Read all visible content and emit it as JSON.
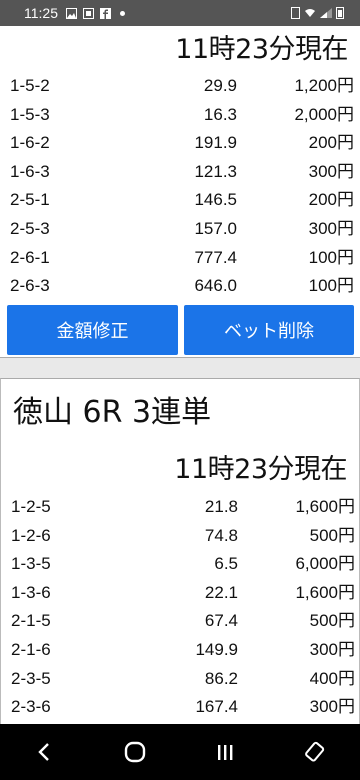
{
  "status_bar": {
    "time": "11:25",
    "icons": [
      "image-icon",
      "gallery-icon",
      "facebook-icon",
      "dot-icon"
    ],
    "right_icons": [
      "hd-icon",
      "wifi-icon",
      "signal-icon",
      "battery-icon"
    ]
  },
  "card1": {
    "as_of": "11時23分現在",
    "rows": [
      {
        "combo": "1-5-2",
        "odds": "29.9",
        "amount": "1,200円"
      },
      {
        "combo": "1-5-3",
        "odds": "16.3",
        "amount": "2,000円"
      },
      {
        "combo": "1-6-2",
        "odds": "191.9",
        "amount": "200円"
      },
      {
        "combo": "1-6-3",
        "odds": "121.3",
        "amount": "300円"
      },
      {
        "combo": "2-5-1",
        "odds": "146.5",
        "amount": "200円"
      },
      {
        "combo": "2-5-3",
        "odds": "157.0",
        "amount": "300円"
      },
      {
        "combo": "2-6-1",
        "odds": "777.4",
        "amount": "100円"
      },
      {
        "combo": "2-6-3",
        "odds": "646.0",
        "amount": "100円"
      }
    ],
    "edit_label": "金額修正",
    "delete_label": "ベット削除"
  },
  "card2": {
    "title": "徳山 6R 3連単",
    "as_of": "11時23分現在",
    "rows": [
      {
        "combo": "1-2-5",
        "odds": "21.8",
        "amount": "1,600円"
      },
      {
        "combo": "1-2-6",
        "odds": "74.8",
        "amount": "500円"
      },
      {
        "combo": "1-3-5",
        "odds": "6.5",
        "amount": "6,000円"
      },
      {
        "combo": "1-3-6",
        "odds": "22.1",
        "amount": "1,600円"
      },
      {
        "combo": "2-1-5",
        "odds": "67.4",
        "amount": "500円"
      },
      {
        "combo": "2-1-6",
        "odds": "149.9",
        "amount": "300円"
      },
      {
        "combo": "2-3-5",
        "odds": "86.2",
        "amount": "400円"
      },
      {
        "combo": "2-3-6",
        "odds": "167.4",
        "amount": "300円"
      }
    ]
  },
  "nav": {
    "back_icon": "back-icon",
    "home_icon": "home-icon",
    "recents_icon": "recents-icon",
    "rotate_icon": "rotate-icon"
  },
  "colors": {
    "button": "#1b74e8",
    "status_bar": "#555555",
    "nav_bar": "#000000"
  }
}
